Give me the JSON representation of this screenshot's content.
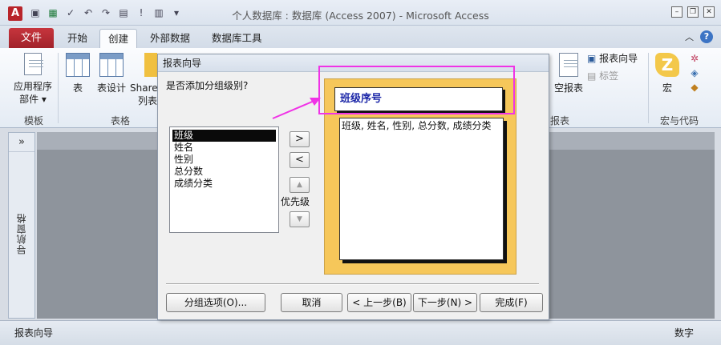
{
  "titlebar": {
    "app_icon": "A",
    "title": "个人数据库 : 数据库 (Access 2007)  -  Microsoft Access",
    "qat_icons": [
      "save-icon",
      "excel-icon",
      "check-icon",
      "undo-icon",
      "redo-icon",
      "import-icon",
      "alert-icon",
      "table-icon",
      "customize-icon"
    ],
    "controls": [
      "minimize",
      "restore",
      "close"
    ]
  },
  "tabs": {
    "file": "文件",
    "items": [
      "开始",
      "创建",
      "外部数据",
      "数据库工具"
    ],
    "active": "创建"
  },
  "ribbon": {
    "templates": {
      "button_line1": "应用程序",
      "button_line2": "部件",
      "group": "模板"
    },
    "tables": {
      "table": "表",
      "table_design": "表设计",
      "sharepoint_line1": "Share",
      "sharepoint_line2": "列表",
      "group": "表格"
    },
    "reports": {
      "blank_report": "空报表",
      "report_wizard": "报表向导",
      "labels": "标签",
      "group": "报表"
    },
    "macros": {
      "macro": "宏",
      "group": "宏与代码"
    }
  },
  "nav": {
    "toggle": "»",
    "label": "导航窗格"
  },
  "status": {
    "left": "报表向导",
    "right": "数字"
  },
  "dialog": {
    "title": "报表向导",
    "question": "是否添加分组级别?",
    "fields": [
      "班级",
      "姓名",
      "性别",
      "总分数",
      "成绩分类"
    ],
    "selected_index": 0,
    "buttons": {
      "add": ">",
      "remove": "<",
      "priority": "优先级"
    },
    "preview": {
      "group_header": "班级序号",
      "detail": "班级, 姓名, 性别, 总分数, 成绩分类"
    },
    "footer": {
      "grouping_options": "分组选项(O)...",
      "cancel": "取消",
      "back": "< 上一步(B)",
      "next": "下一步(N) >",
      "finish": "完成(F)"
    }
  },
  "colors": {
    "file_tab": "#b8242a",
    "annotation": "#f033e6",
    "preview_bg": "#f6c75a",
    "group_header_text": "#1c27a8"
  }
}
